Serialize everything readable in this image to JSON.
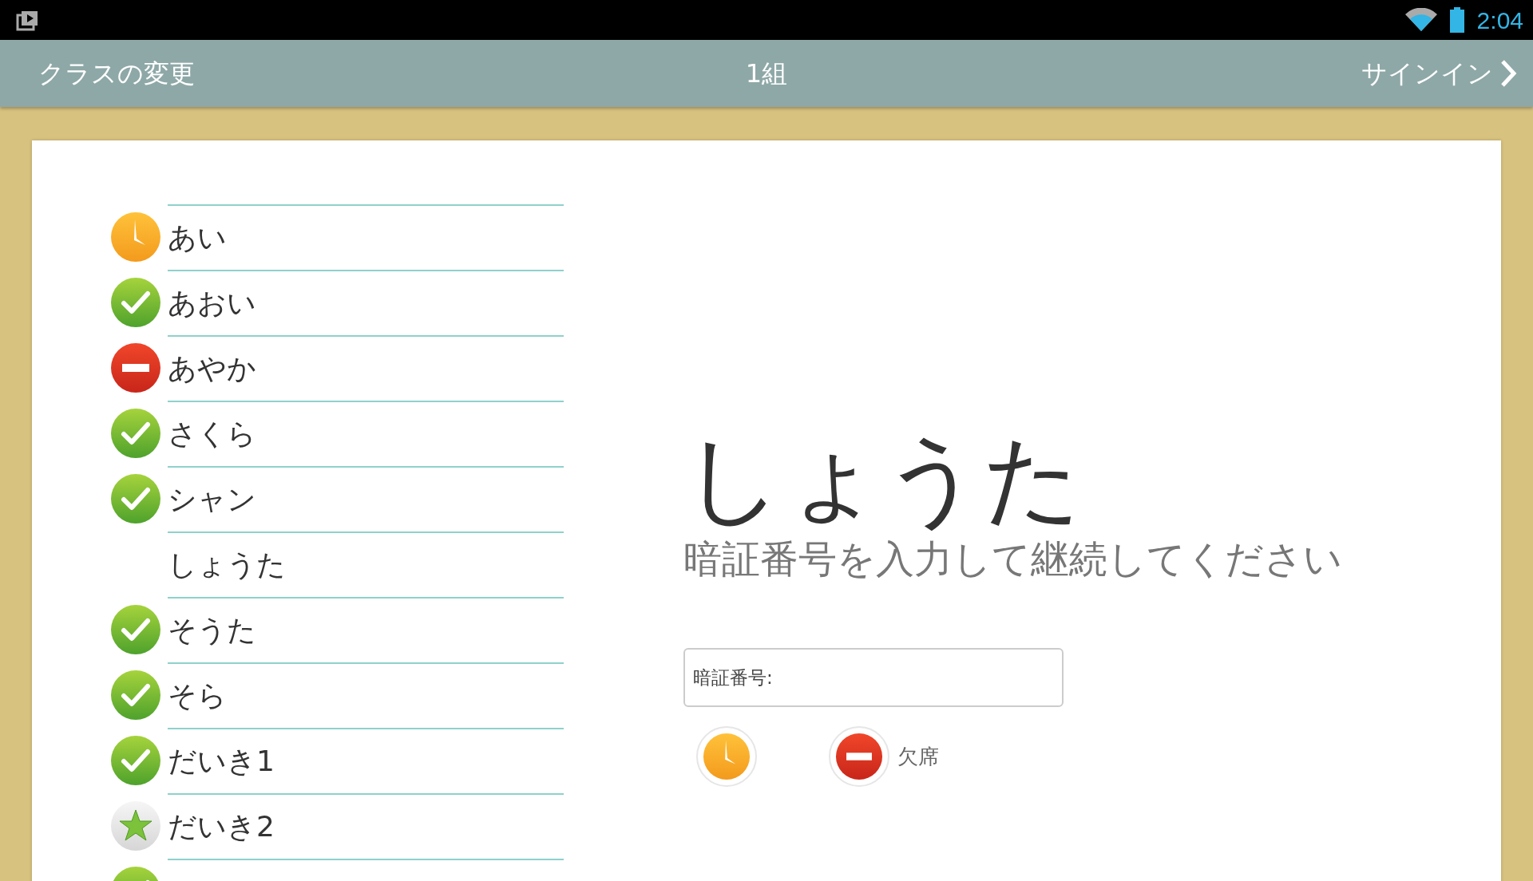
{
  "status_bar": {
    "time": "2:04"
  },
  "app_bar": {
    "back_label": "クラスの変更",
    "title": "1組",
    "next_label": "サインイン"
  },
  "students": [
    {
      "name": "あい",
      "kind": "late"
    },
    {
      "name": "あおい",
      "kind": "present"
    },
    {
      "name": "あやか",
      "kind": "absent"
    },
    {
      "name": "さくら",
      "kind": "present"
    },
    {
      "name": "シャン",
      "kind": "present"
    },
    {
      "name": "しょうた",
      "kind": "none"
    },
    {
      "name": "そうた",
      "kind": "present"
    },
    {
      "name": "そら",
      "kind": "present"
    },
    {
      "name": "だいき1",
      "kind": "present"
    },
    {
      "name": "だいき2",
      "kind": "star"
    },
    {
      "kind": "present"
    }
  ],
  "detail": {
    "name": "しょうた",
    "prompt": "暗証番号を入力して継続してください",
    "pin_field": {
      "placeholder": "暗証番号:"
    },
    "status_buttons": [
      {
        "kind": "late"
      },
      {
        "kind": "absent",
        "label": "欠席"
      }
    ]
  }
}
